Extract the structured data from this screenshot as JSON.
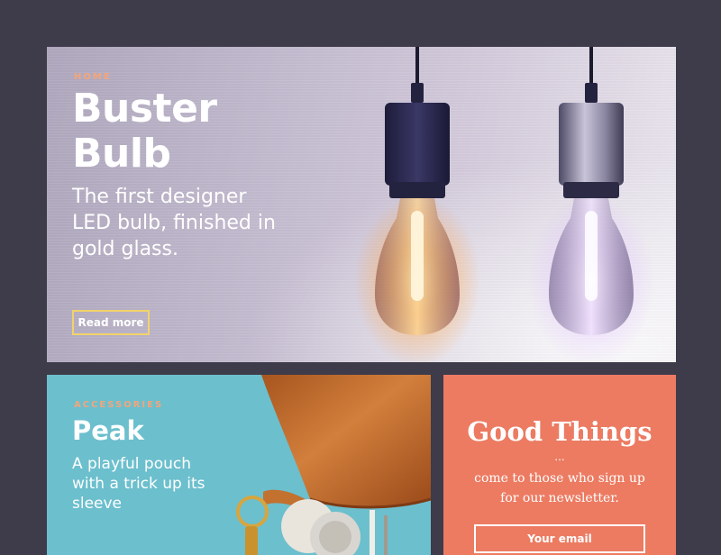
{
  "hero": {
    "category": "HOME",
    "title": "Buster Bulb",
    "description": "The first designer LED bulb, finished in gold glass.",
    "button_label": "Read more"
  },
  "peak": {
    "category": "ACCESSORIES",
    "title": "Peak",
    "description": "A playful pouch with a trick up its sleeve"
  },
  "newsletter": {
    "title": "Good Things",
    "dots": "...",
    "description_line1": "come to those who sign up",
    "description_line2": "for our newsletter.",
    "email_placeholder": "Your email"
  },
  "colors": {
    "page_bg": "#3e3b4a",
    "eyebrow": "#f4a57a",
    "button_border": "#f2d36a",
    "peak_bg": "#6cbfcd",
    "newsletter_bg": "#ec7b62"
  }
}
